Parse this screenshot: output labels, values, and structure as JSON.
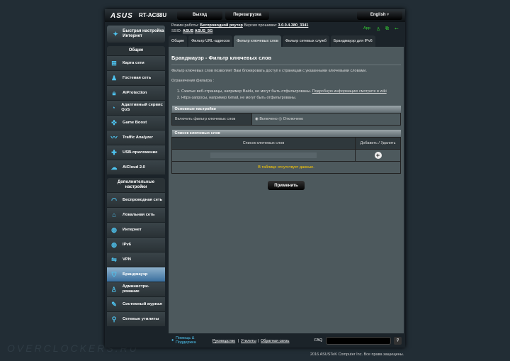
{
  "header": {
    "brand": "ASUS",
    "model": "RT-AC88U",
    "logout": "Выход",
    "reboot": "Перезагрузка",
    "language": "English"
  },
  "info": {
    "mode_label": "Режим работы:",
    "mode_value": "Беспроводной роутер",
    "fw_label": "Версия прошивки:",
    "fw_value": "3.0.0.4.380_3341",
    "ssid_label": "SSID:",
    "ssid1": "ASUS",
    "ssid2": "ASUS_5G",
    "app": "App"
  },
  "sidebar": {
    "quick_setup": "Быстрая настройка Интернет",
    "general_title": "Общие",
    "general": [
      "Карта сети",
      "Гостевая сеть",
      "AiProtection",
      "Адаптивный сервис QoS",
      "Game Boost",
      "Traffic Analyzer",
      "USB-приложение",
      "AiCloud 2.0"
    ],
    "advanced_title": "Дополнительные настройки",
    "advanced": [
      "Беспроводная сеть",
      "Локальная сеть",
      "Интернет",
      "IPv6",
      "VPN",
      "Брандмауэр",
      "Администри-рование",
      "Системный журнал",
      "Сетевые утилиты"
    ]
  },
  "tabs": [
    "Общие",
    "Фильтр URL-адресов",
    "Фильтр ключевых слов",
    "Фильтр сетевых служб",
    "Брандмауэр для IPv6"
  ],
  "main": {
    "title": "Брандмауэр - Фильтр ключевых слов",
    "desc": "Фильтр ключевых слов позволяет Вам блокировать доступ к страницам с указанными ключевыми словами.",
    "limits": "Ограничения фильтра :",
    "limit1": "Сжатые веб-страницы, например Baidu, не могут быть отфильтрованы.",
    "limit1_link": "Подробную информацию смотрите в wiki",
    "limit2": "Https-запросы, например Gmail, не могут быть отфильтрованы.",
    "basic": "Основные настройки",
    "enable_label": "Включить фильтр ключевых слов",
    "on": "Включено",
    "off": "Отключено",
    "list_title": "Список ключевых слов",
    "col_keywords": "Список ключевых слов",
    "col_action": "Добавить / Удалить",
    "empty": "В таблице отсутствует данные.",
    "apply": "Применить"
  },
  "footer": {
    "help": "Помощь & Поддержка",
    "manual": "Руководство",
    "utils": "Утилиты",
    "feedback": "Обратная связь",
    "faq": "FAQ",
    "copyright": "2016 ASUSTeK Computer Inc. Все права защищены.",
    "watermark": "OVERCLOCKERS.RU"
  }
}
